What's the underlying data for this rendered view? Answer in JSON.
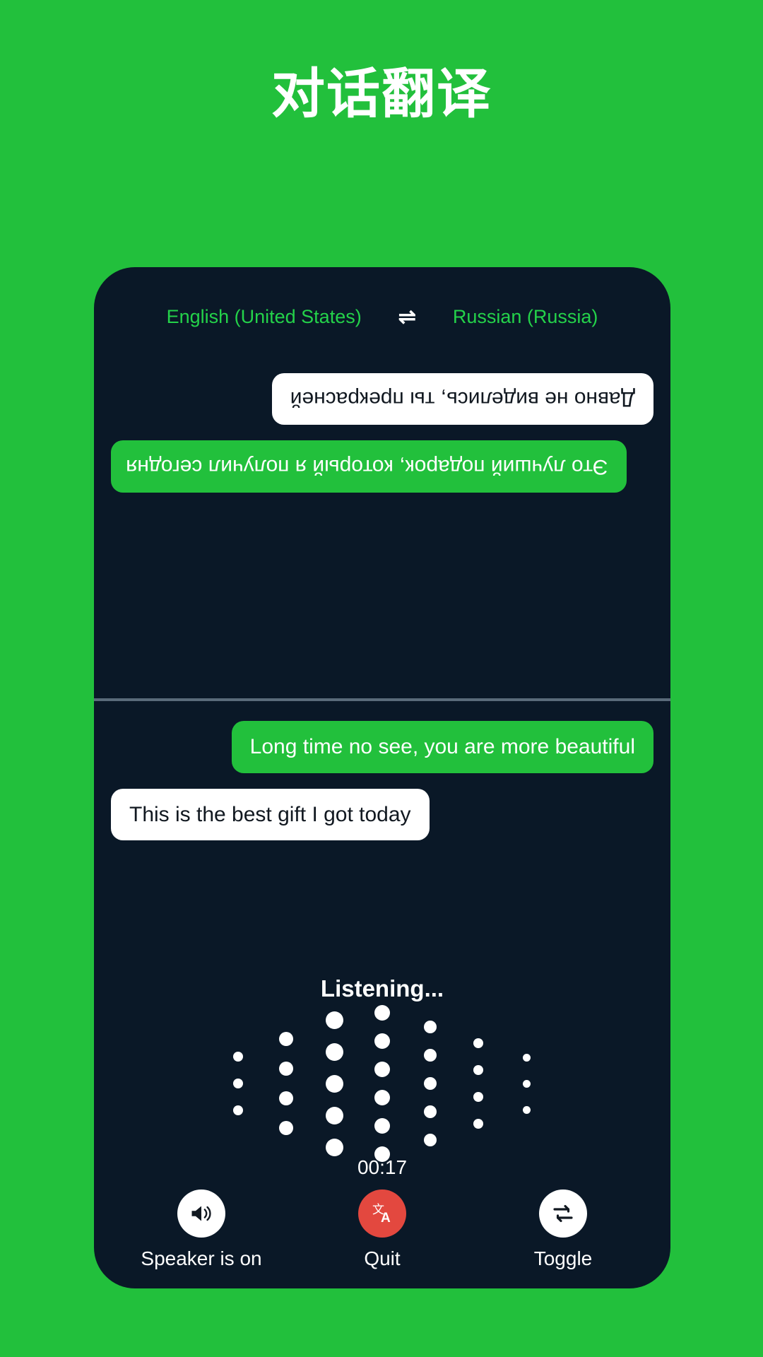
{
  "page": {
    "title": "对话翻译",
    "background_color": "#22C03C"
  },
  "phone": {
    "background_color": "#0A1827",
    "language_bar": {
      "source_language": "English (United States)",
      "swap_icon": "swap-horizontal-icon",
      "swap_glyph": "⇌",
      "target_language": "Russian (Russia)",
      "text_color": "#24D24A"
    },
    "conversation_top": {
      "rotated": true,
      "messages": [
        {
          "text": "Это лучший подарок, который я получил сегодня",
          "style": "green",
          "align": "right"
        },
        {
          "text": "Давно не виделись, ты прекрасней",
          "style": "white",
          "align": "left"
        }
      ]
    },
    "conversation_bottom": {
      "rotated": false,
      "messages": [
        {
          "text": "Long time no see, you are more beautiful",
          "style": "green",
          "align": "right"
        },
        {
          "text": "This is the best gift I got today",
          "style": "white",
          "align": "left"
        }
      ]
    },
    "status": {
      "listening_label": "Listening...",
      "timer": "00:17"
    },
    "waveform": {
      "dot_color": "#FFFFFF",
      "columns": [
        {
          "dot_size": 14,
          "count": 3,
          "gap": 24
        },
        {
          "dot_size": 20,
          "count": 4,
          "gap": 22
        },
        {
          "dot_size": 25,
          "count": 5,
          "gap": 20
        },
        {
          "dot_size": 22,
          "count": 6,
          "gap": 18
        },
        {
          "dot_size": 18,
          "count": 5,
          "gap": 22
        },
        {
          "dot_size": 14,
          "count": 4,
          "gap": 24
        },
        {
          "dot_size": 11,
          "count": 3,
          "gap": 26
        }
      ]
    },
    "controls": [
      {
        "label": "Speaker is on",
        "icon": "speaker-on-icon",
        "circle_color": "#FFFFFF",
        "icon_color": "#111820"
      },
      {
        "label": "Quit",
        "icon": "translate-icon",
        "circle_color": "#E3483F",
        "icon_color": "#FFFFFF"
      },
      {
        "label": "Toggle",
        "icon": "repeat-swap-icon",
        "circle_color": "#FFFFFF",
        "icon_color": "#111820"
      }
    ]
  }
}
